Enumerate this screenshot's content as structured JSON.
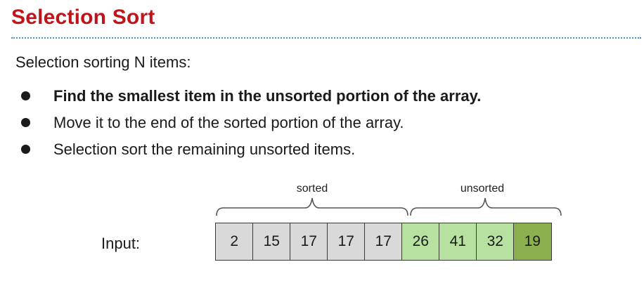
{
  "slide": {
    "title": "Selection Sort",
    "intro": "Selection sorting N items:",
    "bullets": [
      {
        "text": "Find the smallest item in the unsorted portion of the array.",
        "bold": true
      },
      {
        "text": "Move it to the end of the sorted portion of the array.",
        "bold": false
      },
      {
        "text": "Selection sort the remaining unsorted items.",
        "bold": false
      }
    ],
    "colors": {
      "title": "#c0141b",
      "rule": "#4a8fd4",
      "sorted_cell": "#d9d9d9",
      "unsorted_cell": "#b7e1a1",
      "min_cell": "#8db04f"
    }
  },
  "diagram": {
    "input_label": "Input:",
    "sorted_label": "sorted",
    "unsorted_label": "unsorted",
    "cells": [
      {
        "value": "2",
        "state": "sorted"
      },
      {
        "value": "15",
        "state": "sorted"
      },
      {
        "value": "17",
        "state": "sorted"
      },
      {
        "value": "17",
        "state": "sorted"
      },
      {
        "value": "17",
        "state": "sorted"
      },
      {
        "value": "26",
        "state": "unsorted"
      },
      {
        "value": "41",
        "state": "unsorted"
      },
      {
        "value": "32",
        "state": "unsorted"
      },
      {
        "value": "19",
        "state": "min"
      }
    ]
  }
}
